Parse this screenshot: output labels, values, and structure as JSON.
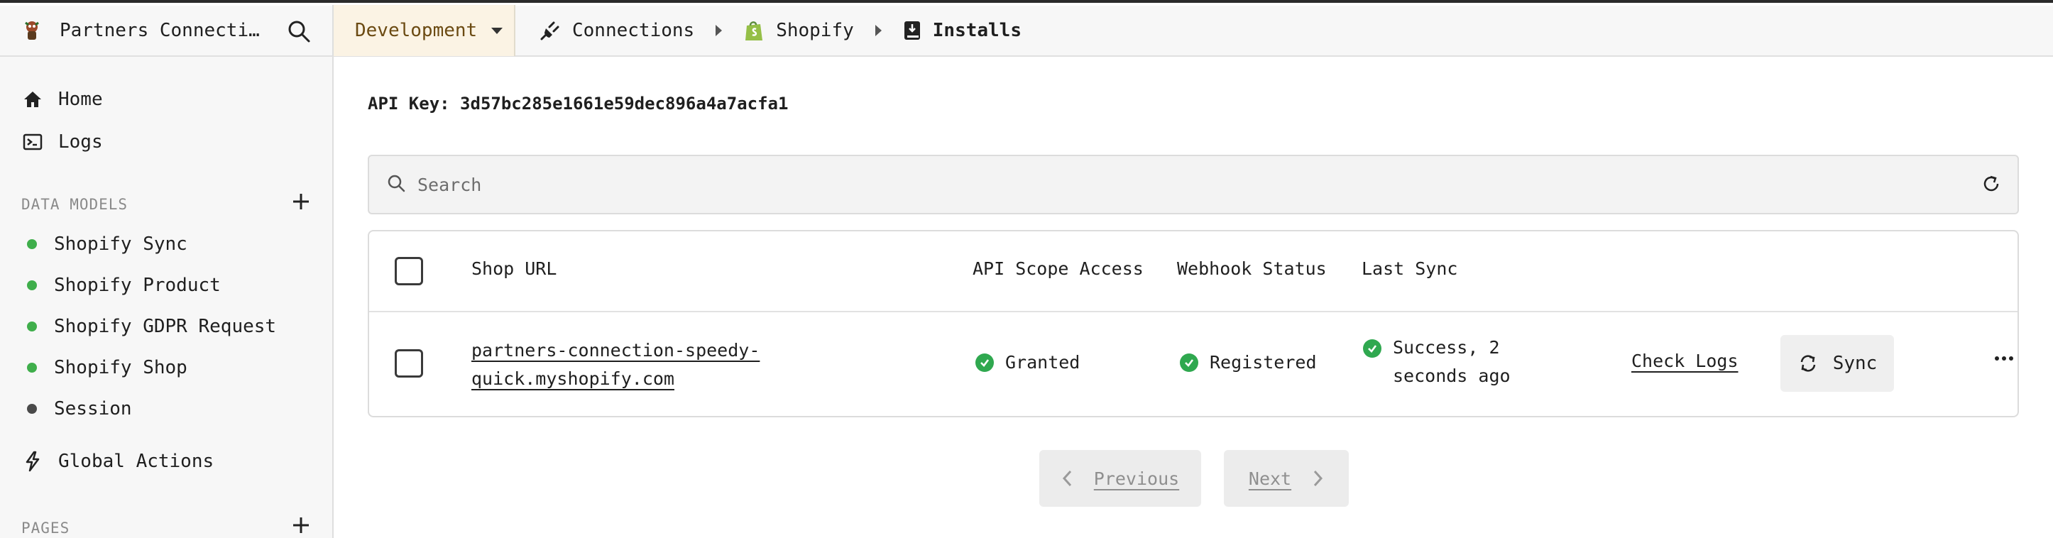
{
  "header": {
    "app_name": "Partners Connectio…",
    "environment": "Development",
    "breadcrumbs": [
      {
        "label": "Connections",
        "icon": "plug-icon"
      },
      {
        "label": "Shopify",
        "icon": "shopify-bag-icon"
      },
      {
        "label": "Installs",
        "icon": "book-download-icon"
      }
    ]
  },
  "sidebar": {
    "nav": [
      {
        "label": "Home",
        "icon": "home-icon"
      },
      {
        "label": "Logs",
        "icon": "terminal-icon"
      }
    ],
    "data_models_label": "DATA MODELS",
    "models": [
      {
        "label": "Shopify Sync",
        "color": "#3fae4b"
      },
      {
        "label": "Shopify Product",
        "color": "#3fae4b"
      },
      {
        "label": "Shopify GDPR Request",
        "color": "#3fae4b"
      },
      {
        "label": "Shopify Shop",
        "color": "#3fae4b"
      },
      {
        "label": "Session",
        "color": "#4a4a4a"
      }
    ],
    "global_actions_label": "Global Actions",
    "pages_label": "PAGES"
  },
  "main": {
    "api_key": "API Key: 3d57bc285e1661e59dec896a4a7acfa1",
    "search_placeholder": "Search",
    "table": {
      "columns": [
        "Shop URL",
        "API Scope Access",
        "Webhook Status",
        "Last Sync"
      ],
      "rows": [
        {
          "shop_url": "partners-connection-speedy-quick.myshopify.com",
          "api_scope": "Granted",
          "webhook": "Registered",
          "last_sync": "Success, 2 seconds ago",
          "check_logs": "Check Logs",
          "sync_label": "Sync"
        }
      ]
    },
    "pagination": {
      "previous": "Previous",
      "next": "Next"
    }
  },
  "colors": {
    "success": "#2fa84f",
    "env_bg": "#fbf3e4"
  }
}
